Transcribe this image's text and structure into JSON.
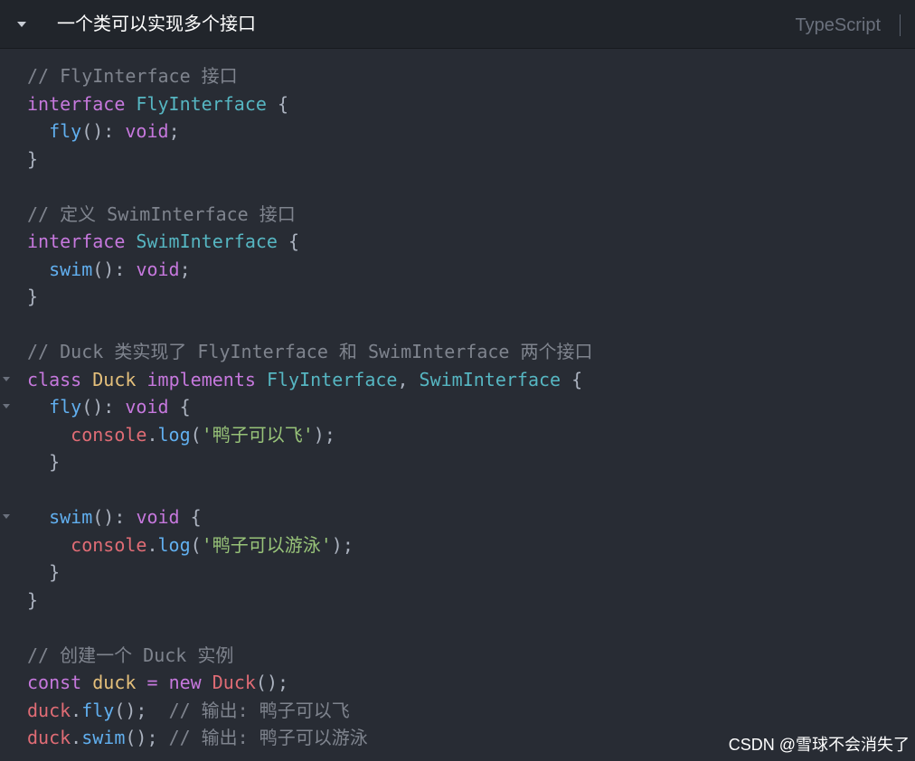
{
  "header": {
    "title": "一个类可以实现多个接口",
    "language": "TypeScript"
  },
  "code": {
    "lines": [
      {
        "fold": false,
        "indent": 0,
        "tokens": [
          {
            "t": "// FlyInterface 接口",
            "c": "comment"
          }
        ]
      },
      {
        "fold": false,
        "indent": 0,
        "tokens": [
          {
            "t": "interface",
            "c": "keyword"
          },
          {
            "t": " ",
            "c": "punct"
          },
          {
            "t": "FlyInterface",
            "c": "type"
          },
          {
            "t": " {",
            "c": "punct"
          }
        ]
      },
      {
        "fold": false,
        "indent": 1,
        "tokens": [
          {
            "t": "fly",
            "c": "func"
          },
          {
            "t": "(): ",
            "c": "punct"
          },
          {
            "t": "void",
            "c": "keyword"
          },
          {
            "t": ";",
            "c": "punct"
          }
        ]
      },
      {
        "fold": false,
        "indent": 0,
        "tokens": [
          {
            "t": "}",
            "c": "punct"
          }
        ]
      },
      {
        "fold": false,
        "indent": 0,
        "tokens": []
      },
      {
        "fold": false,
        "indent": 0,
        "tokens": [
          {
            "t": "// 定义 SwimInterface 接口",
            "c": "comment"
          }
        ]
      },
      {
        "fold": false,
        "indent": 0,
        "tokens": [
          {
            "t": "interface",
            "c": "keyword"
          },
          {
            "t": " ",
            "c": "punct"
          },
          {
            "t": "SwimInterface",
            "c": "type"
          },
          {
            "t": " {",
            "c": "punct"
          }
        ]
      },
      {
        "fold": false,
        "indent": 1,
        "tokens": [
          {
            "t": "swim",
            "c": "func"
          },
          {
            "t": "(): ",
            "c": "punct"
          },
          {
            "t": "void",
            "c": "keyword"
          },
          {
            "t": ";",
            "c": "punct"
          }
        ]
      },
      {
        "fold": false,
        "indent": 0,
        "tokens": [
          {
            "t": "}",
            "c": "punct"
          }
        ]
      },
      {
        "fold": false,
        "indent": 0,
        "tokens": []
      },
      {
        "fold": false,
        "indent": 0,
        "tokens": [
          {
            "t": "// Duck 类实现了 FlyInterface 和 SwimInterface 两个接口",
            "c": "comment"
          }
        ]
      },
      {
        "fold": true,
        "indent": 0,
        "tokens": [
          {
            "t": "class",
            "c": "keyword"
          },
          {
            "t": " ",
            "c": "punct"
          },
          {
            "t": "Duck",
            "c": "class"
          },
          {
            "t": " ",
            "c": "punct"
          },
          {
            "t": "implements",
            "c": "keyword"
          },
          {
            "t": " ",
            "c": "punct"
          },
          {
            "t": "FlyInterface",
            "c": "type"
          },
          {
            "t": ", ",
            "c": "punct"
          },
          {
            "t": "SwimInterface",
            "c": "type"
          },
          {
            "t": " {",
            "c": "punct"
          }
        ]
      },
      {
        "fold": true,
        "indent": 1,
        "tokens": [
          {
            "t": "fly",
            "c": "func"
          },
          {
            "t": "(): ",
            "c": "punct"
          },
          {
            "t": "void",
            "c": "keyword"
          },
          {
            "t": " {",
            "c": "punct"
          }
        ]
      },
      {
        "fold": false,
        "indent": 2,
        "tokens": [
          {
            "t": "console",
            "c": "var"
          },
          {
            "t": ".",
            "c": "punct"
          },
          {
            "t": "log",
            "c": "func"
          },
          {
            "t": "(",
            "c": "punct"
          },
          {
            "t": "'鸭子可以飞'",
            "c": "string"
          },
          {
            "t": ");",
            "c": "punct"
          }
        ]
      },
      {
        "fold": false,
        "indent": 1,
        "tokens": [
          {
            "t": "}",
            "c": "punct"
          }
        ]
      },
      {
        "fold": false,
        "indent": 0,
        "tokens": []
      },
      {
        "fold": true,
        "indent": 1,
        "tokens": [
          {
            "t": "swim",
            "c": "func"
          },
          {
            "t": "(): ",
            "c": "punct"
          },
          {
            "t": "void",
            "c": "keyword"
          },
          {
            "t": " {",
            "c": "punct"
          }
        ]
      },
      {
        "fold": false,
        "indent": 2,
        "tokens": [
          {
            "t": "console",
            "c": "var"
          },
          {
            "t": ".",
            "c": "punct"
          },
          {
            "t": "log",
            "c": "func"
          },
          {
            "t": "(",
            "c": "punct"
          },
          {
            "t": "'鸭子可以游泳'",
            "c": "string"
          },
          {
            "t": ");",
            "c": "punct"
          }
        ]
      },
      {
        "fold": false,
        "indent": 1,
        "tokens": [
          {
            "t": "}",
            "c": "punct"
          }
        ]
      },
      {
        "fold": false,
        "indent": 0,
        "tokens": [
          {
            "t": "}",
            "c": "punct"
          }
        ]
      },
      {
        "fold": false,
        "indent": 0,
        "tokens": []
      },
      {
        "fold": false,
        "indent": 0,
        "tokens": [
          {
            "t": "// 创建一个 Duck 实例",
            "c": "comment"
          }
        ]
      },
      {
        "fold": false,
        "indent": 0,
        "tokens": [
          {
            "t": "const",
            "c": "keyword"
          },
          {
            "t": " ",
            "c": "punct"
          },
          {
            "t": "duck",
            "c": "class"
          },
          {
            "t": " ",
            "c": "punct"
          },
          {
            "t": "=",
            "c": "keyword"
          },
          {
            "t": " ",
            "c": "punct"
          },
          {
            "t": "new",
            "c": "keyword"
          },
          {
            "t": " ",
            "c": "punct"
          },
          {
            "t": "Duck",
            "c": "var"
          },
          {
            "t": "();",
            "c": "punct"
          }
        ]
      },
      {
        "fold": false,
        "indent": 0,
        "tokens": [
          {
            "t": "duck",
            "c": "var"
          },
          {
            "t": ".",
            "c": "punct"
          },
          {
            "t": "fly",
            "c": "func"
          },
          {
            "t": "();  ",
            "c": "punct"
          },
          {
            "t": "// 输出: 鸭子可以飞",
            "c": "comment"
          }
        ]
      },
      {
        "fold": false,
        "indent": 0,
        "tokens": [
          {
            "t": "duck",
            "c": "var"
          },
          {
            "t": ".",
            "c": "punct"
          },
          {
            "t": "swim",
            "c": "func"
          },
          {
            "t": "(); ",
            "c": "punct"
          },
          {
            "t": "// 输出: 鸭子可以游泳",
            "c": "comment"
          }
        ]
      }
    ]
  },
  "watermark": "CSDN @雪球不会消失了",
  "icons": {
    "collapse": "caret-down-icon",
    "fold": "fold-arrow-icon"
  }
}
